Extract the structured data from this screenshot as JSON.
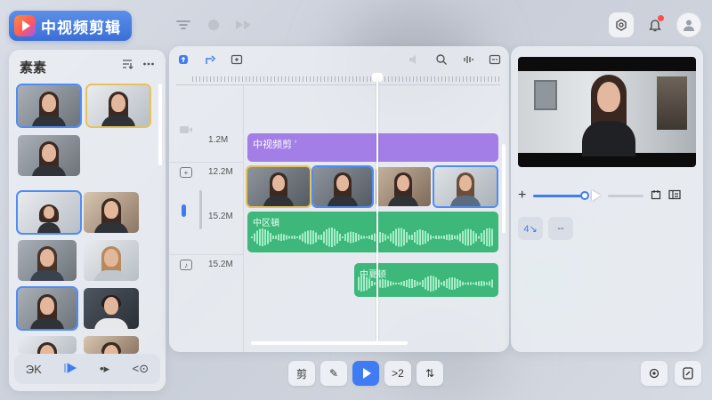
{
  "app": {
    "title": "中视频剪辑"
  },
  "media_panel": {
    "title": "素素",
    "bottom_tools": [
      {
        "label": "ЭK",
        "icon": "cut-icon"
      },
      {
        "label": "▸",
        "icon": "play-marker-icon"
      },
      {
        "label": "•▸",
        "icon": "next-icon"
      },
      {
        "label": "<⊙",
        "icon": "view-icon"
      }
    ]
  },
  "timeline": {
    "tracks": [
      {
        "label": "1.2M"
      },
      {
        "label": "12.2M"
      },
      {
        "label": "15.2M"
      },
      {
        "label": "15.2M"
      }
    ],
    "title_clip": "中视频剪 ʹ",
    "audio_clip_1": "中区頓",
    "audio_clip_2": "中夏顿"
  },
  "preview": {
    "chips": [
      "4↘",
      "--"
    ]
  },
  "bottom_controls": [
    {
      "label": "剪",
      "icon": "cut-icon"
    },
    {
      "label": "✎",
      "icon": "pen-icon"
    },
    {
      "label": "",
      "icon": "play-icon"
    },
    {
      "label": ">2",
      "icon": "speed-icon"
    },
    {
      "label": "⇅",
      "icon": "split-icon"
    }
  ],
  "colors": {
    "accent": "#3f7cf4",
    "title_clip": "#a37ee6",
    "audio_clip": "#3db87a",
    "notification": "#ff4d4f"
  }
}
